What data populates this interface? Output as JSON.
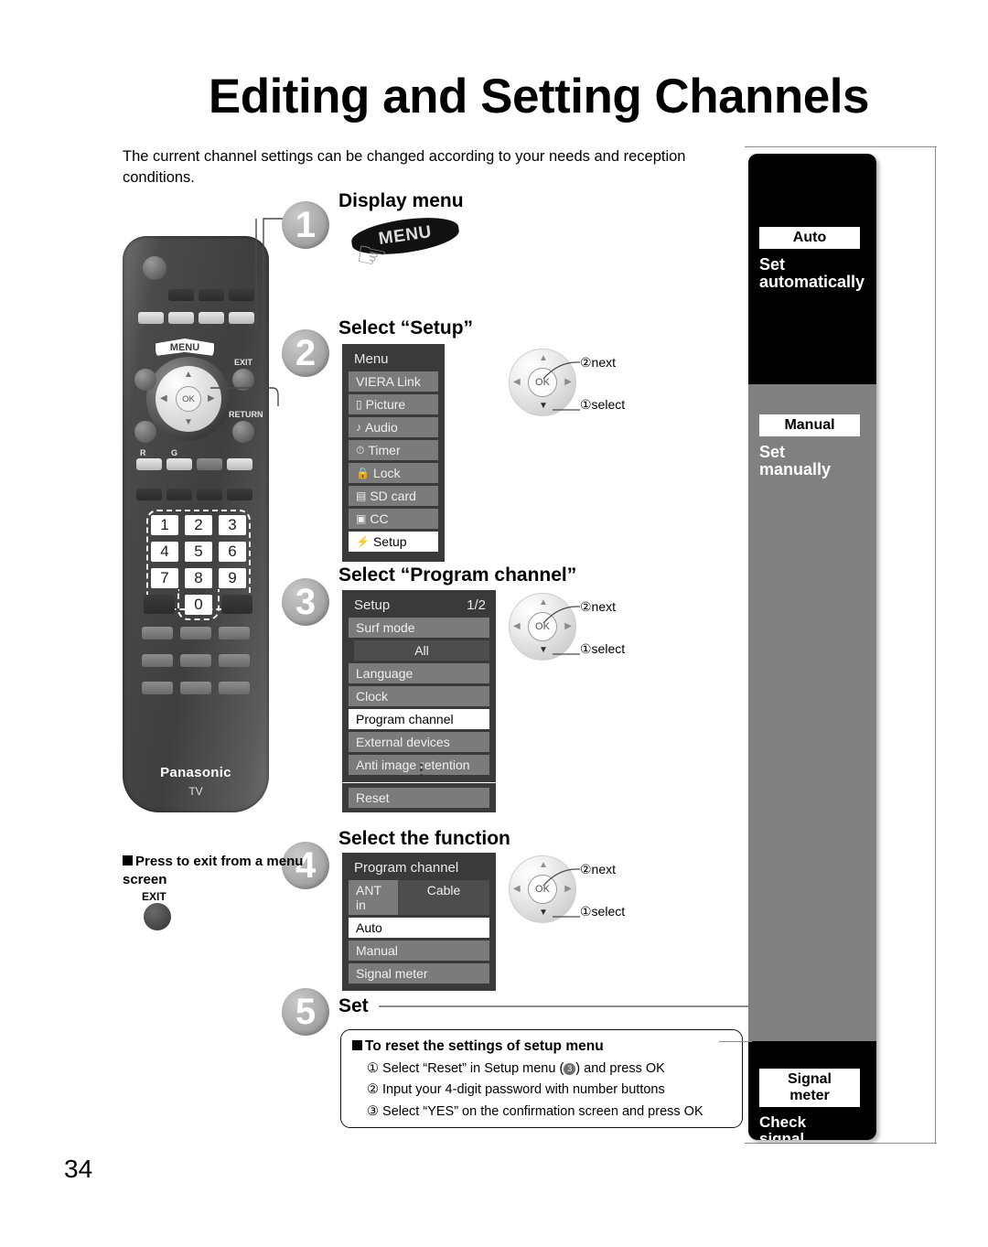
{
  "page": {
    "title": "Editing and Setting Channels",
    "intro": "The current channel settings can be changed according to your needs and reception conditions.",
    "page_number": "34"
  },
  "steps": [
    {
      "num": "1",
      "heading": "Display menu"
    },
    {
      "num": "2",
      "heading": "Select “Setup”"
    },
    {
      "num": "3",
      "heading": "Select “Program channel”"
    },
    {
      "num": "4",
      "heading": "Select the function"
    },
    {
      "num": "5",
      "heading": "Set"
    }
  ],
  "menu_banner": {
    "label": "MENU",
    "icon": "pointing-hand-icon"
  },
  "menu_panel": {
    "title": "Menu",
    "items": [
      {
        "label": "VIERA Link",
        "icon": "",
        "selected": false
      },
      {
        "label": "Picture",
        "icon": "▭",
        "selected": false
      },
      {
        "label": "Audio",
        "icon": "♪",
        "selected": false
      },
      {
        "label": "Timer",
        "icon": "⏱",
        "selected": false
      },
      {
        "label": "Lock",
        "icon": "ὑ2",
        "selected": false
      },
      {
        "label": "SD card",
        "icon": "▤",
        "selected": false
      },
      {
        "label": "CC",
        "icon": "▣",
        "selected": false
      },
      {
        "label": "Setup",
        "icon": "⚡",
        "selected": true
      }
    ]
  },
  "setup_panel": {
    "title": "Setup",
    "page_indicator": "1/2",
    "items": [
      {
        "label": "Surf mode",
        "value": "All",
        "selected": false
      },
      {
        "label": "Language",
        "selected": false
      },
      {
        "label": "Clock",
        "selected": false
      },
      {
        "label": "Program channel",
        "selected": true
      },
      {
        "label": "External devices",
        "selected": false
      },
      {
        "label": "Anti image retention",
        "selected": false
      }
    ],
    "ellipsis": "⋮",
    "reset_row": {
      "label": "Reset",
      "selected": false
    }
  },
  "program_channel_panel": {
    "title": "Program channel",
    "ant_in": {
      "label": "ANT in",
      "value": "Cable"
    },
    "items": [
      {
        "label": "Auto",
        "selected": true
      },
      {
        "label": "Manual",
        "selected": false
      },
      {
        "label": "Signal meter",
        "selected": false
      }
    ]
  },
  "nav_callouts": {
    "next": "②next",
    "select": "①select",
    "ok": "OK"
  },
  "sidebar": {
    "tabs": [
      {
        "label": "Auto",
        "description": "Set\nautomatically",
        "theme": "black"
      },
      {
        "label": "Manual",
        "description": "Set\nmanually",
        "theme": "gray"
      },
      {
        "label": "Signal\nmeter",
        "description": "Check\nsignal\nstrength",
        "theme": "black"
      }
    ]
  },
  "reset_box": {
    "heading": "To reset the settings of setup menu",
    "items": [
      {
        "num": "①",
        "text_before": "Select “Reset” in Setup menu (",
        "badge": "3",
        "text_after": ") and press OK"
      },
      {
        "num": "②",
        "text": "Input your 4-digit password with number buttons"
      },
      {
        "num": "③",
        "text": "Select “YES” on the confirmation screen and press OK"
      }
    ]
  },
  "exit_note": {
    "text": "Press to exit from a menu screen",
    "button_label": "EXIT"
  },
  "remote": {
    "menu_label": "MENU",
    "exit_label": "EXIT",
    "return_label": "RETURN",
    "ok_label": "OK",
    "color_r": "R",
    "color_g": "G",
    "brand": "Panasonic",
    "brand_sub": "TV",
    "numbers": [
      "1",
      "2",
      "3",
      "4",
      "5",
      "6",
      "7",
      "8",
      "9",
      "0"
    ]
  },
  "colors": {
    "osd_bg": "#3a3a3a",
    "osd_row": "#7b7b7b",
    "osd_selected": "#ffffff",
    "sidebar_black": "#000000",
    "sidebar_gray": "#808080"
  }
}
